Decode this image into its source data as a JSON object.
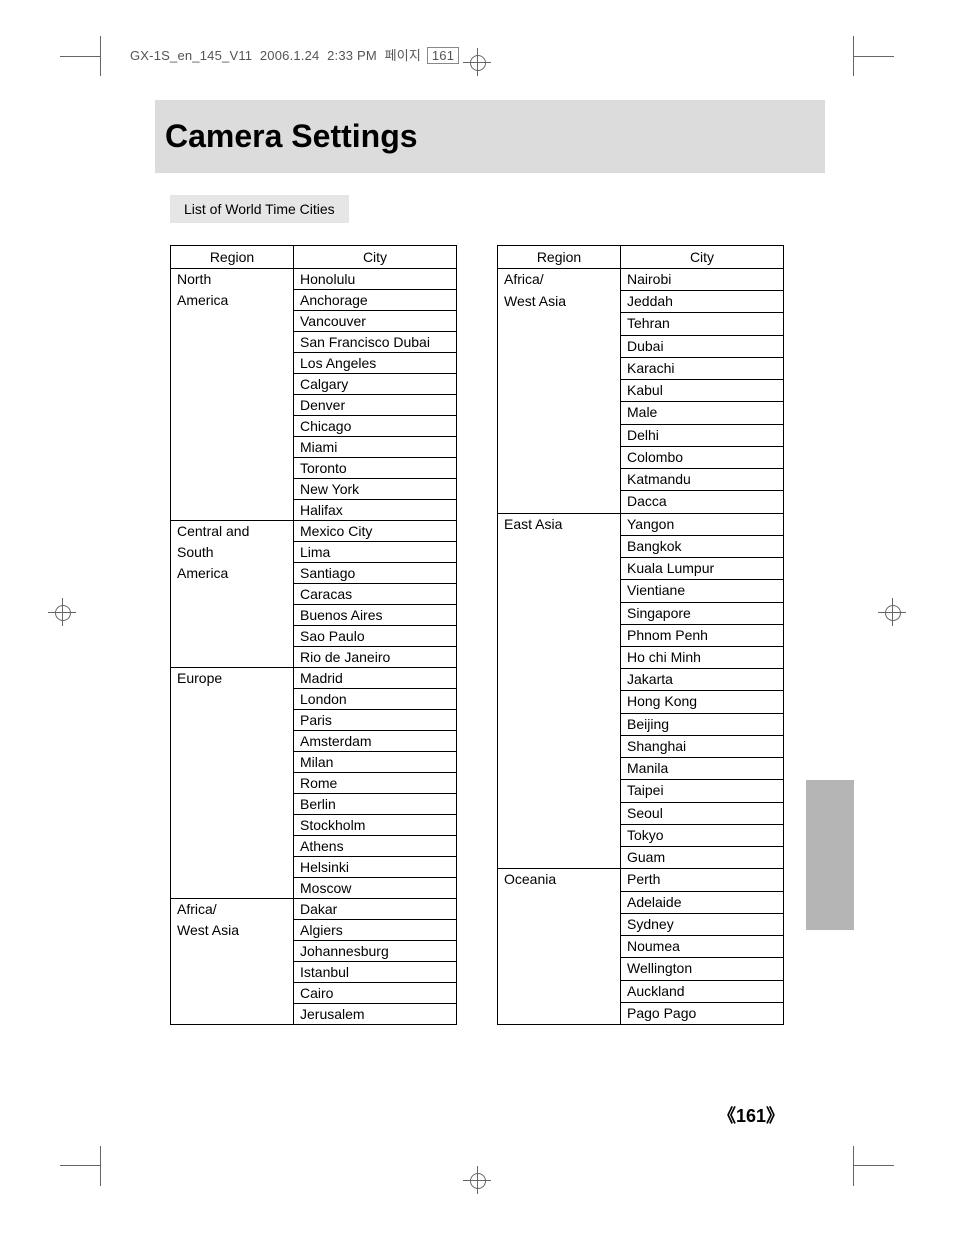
{
  "meta": {
    "doc": "GX-1S_en_145_V11",
    "date": "2006.1.24",
    "time": "2:33 PM",
    "page_label": "페이지",
    "page_num_inline": "161"
  },
  "title": "Camera Settings",
  "subtitle": "List of World Time Cities",
  "headers": {
    "region": "Region",
    "city": "City"
  },
  "left_rows": [
    {
      "region": "North",
      "city": "Honolulu"
    },
    {
      "region": "America",
      "city": "Anchorage"
    },
    {
      "region": "",
      "city": "Vancouver"
    },
    {
      "region": "",
      "city": "San Francisco Dubai"
    },
    {
      "region": "",
      "city": "Los Angeles"
    },
    {
      "region": "",
      "city": "Calgary"
    },
    {
      "region": "",
      "city": "Denver"
    },
    {
      "region": "",
      "city": "Chicago"
    },
    {
      "region": "",
      "city": "Miami"
    },
    {
      "region": "",
      "city": "Toronto"
    },
    {
      "region": "",
      "city": "New York"
    },
    {
      "region": "",
      "city": "Halifax"
    },
    {
      "region": "Central and",
      "city": "Mexico City",
      "newgroup": true
    },
    {
      "region": "South",
      "city": "Lima"
    },
    {
      "region": "America",
      "city": "Santiago"
    },
    {
      "region": "",
      "city": "Caracas"
    },
    {
      "region": "",
      "city": "Buenos Aires"
    },
    {
      "region": "",
      "city": "Sao Paulo"
    },
    {
      "region": "",
      "city": "Rio de Janeiro"
    },
    {
      "region": "Europe",
      "city": "Madrid",
      "newgroup": true
    },
    {
      "region": "",
      "city": "London"
    },
    {
      "region": "",
      "city": "Paris"
    },
    {
      "region": "",
      "city": "Amsterdam"
    },
    {
      "region": "",
      "city": "Milan"
    },
    {
      "region": "",
      "city": "Rome"
    },
    {
      "region": "",
      "city": "Berlin"
    },
    {
      "region": "",
      "city": "Stockholm"
    },
    {
      "region": "",
      "city": "Athens"
    },
    {
      "region": "",
      "city": "Helsinki"
    },
    {
      "region": "",
      "city": "Moscow"
    },
    {
      "region": "Africa/",
      "city": "Dakar",
      "newgroup": true
    },
    {
      "region": "West Asia",
      "city": "Algiers"
    },
    {
      "region": "",
      "city": "Johannesburg"
    },
    {
      "region": "",
      "city": "Istanbul"
    },
    {
      "region": "",
      "city": "Cairo"
    },
    {
      "region": "",
      "city": "Jerusalem"
    }
  ],
  "right_rows": [
    {
      "region": "Africa/",
      "city": "Nairobi"
    },
    {
      "region": "West Asia",
      "city": "Jeddah"
    },
    {
      "region": "",
      "city": "Tehran"
    },
    {
      "region": "",
      "city": "Dubai"
    },
    {
      "region": "",
      "city": "Karachi"
    },
    {
      "region": "",
      "city": "Kabul"
    },
    {
      "region": "",
      "city": "Male"
    },
    {
      "region": "",
      "city": "Delhi"
    },
    {
      "region": "",
      "city": "Colombo"
    },
    {
      "region": "",
      "city": "Katmandu"
    },
    {
      "region": "",
      "city": "Dacca"
    },
    {
      "region": "East Asia",
      "city": "Yangon",
      "newgroup": true
    },
    {
      "region": "",
      "city": "Bangkok"
    },
    {
      "region": "",
      "city": "Kuala Lumpur"
    },
    {
      "region": "",
      "city": "Vientiane"
    },
    {
      "region": "",
      "city": "Singapore"
    },
    {
      "region": "",
      "city": "Phnom Penh"
    },
    {
      "region": "",
      "city": "Ho chi Minh"
    },
    {
      "region": "",
      "city": "Jakarta"
    },
    {
      "region": "",
      "city": "Hong Kong"
    },
    {
      "region": "",
      "city": "Beijing"
    },
    {
      "region": "",
      "city": "Shanghai"
    },
    {
      "region": "",
      "city": "Manila"
    },
    {
      "region": "",
      "city": "Taipei"
    },
    {
      "region": "",
      "city": "Seoul"
    },
    {
      "region": "",
      "city": "Tokyo"
    },
    {
      "region": "",
      "city": "Guam"
    },
    {
      "region": "Oceania",
      "city": "Perth",
      "newgroup": true
    },
    {
      "region": "",
      "city": "Adelaide"
    },
    {
      "region": "",
      "city": "Sydney"
    },
    {
      "region": "",
      "city": "Noumea"
    },
    {
      "region": "",
      "city": "Wellington"
    },
    {
      "region": "",
      "city": "Auckland"
    },
    {
      "region": "",
      "city": "Pago Pago"
    }
  ],
  "page_number": "161"
}
